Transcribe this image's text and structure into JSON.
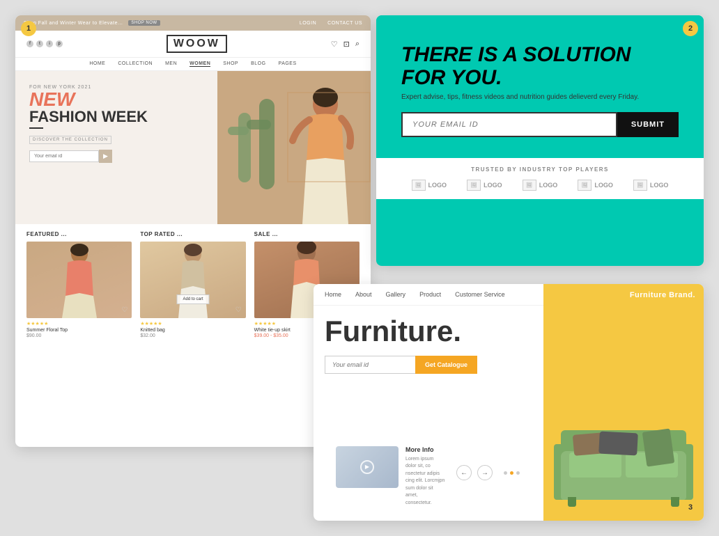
{
  "cards": {
    "card1": {
      "number": "1",
      "topbar": {
        "text": "Shop Fall and Winter Wear to Elevate...",
        "button": "SHOP NOW",
        "login": "LOGIN",
        "contact": "CONTACT US"
      },
      "logo": "WOOW",
      "nav": [
        "HOME",
        "COLLECTION",
        "MEN",
        "WOMEN",
        "SHOP",
        "BLOG",
        "PAGES"
      ],
      "hero": {
        "subtitle": "For New York 2021",
        "title1": "NEW",
        "title2": "FASHION WEEK",
        "discover": "DISCOVER THE COLLECTION",
        "email_placeholder": "Your email id",
        "subscribe_icon": "▶"
      },
      "products": {
        "featured_label": "FEATURED ...",
        "top_rated_label": "TOP RATED ...",
        "sale_label": "SALE ...",
        "items": [
          {
            "name": "Summer Floral Top",
            "price": "$90.00",
            "stars": "★★★★★"
          },
          {
            "name": "Knitted bag",
            "price": "$32.00",
            "overlay_text": "Add to cart",
            "stars": "★★★★★"
          },
          {
            "name": "White tie-up skirt",
            "price": "$39.00 - $35.00",
            "stars": "★★★★★"
          }
        ]
      }
    },
    "card2": {
      "number": "2",
      "headline": "THERE IS A SOLUTION FOR YOU.",
      "subtext": "Expert advise, tips, fitness videos and nutrition guides delieverd every Friday.",
      "email_placeholder": "YOUR EMAIL ID",
      "submit_label": "SUBMIT",
      "trusted_label": "TRUSTED BY INDUSTRY TOP PLAYERS",
      "logos": [
        "LOGO",
        "LOGO",
        "LOGO",
        "LOGO",
        "LOGO"
      ]
    },
    "card3": {
      "number": "3",
      "nav": [
        "Home",
        "About",
        "Gallery",
        "Product",
        "Customer Service"
      ],
      "brand_title": "Furniture Brand.",
      "headline": "Furniture.",
      "email_placeholder": "Your email id",
      "catalogue_btn": "Get Catalogue",
      "video_section": {
        "more_info_title": "More Info",
        "more_info_text": "Lorem ipsum dolor sit, co nsectetur adipis cing elit. Lorcmjpn sum dolor sit amet, consectetur."
      },
      "nav_arrows": [
        "←",
        "→"
      ]
    }
  }
}
